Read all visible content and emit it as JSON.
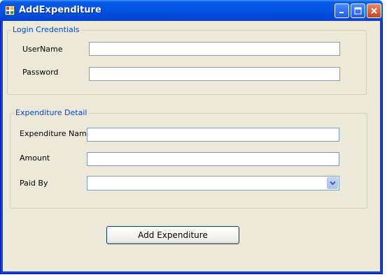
{
  "window": {
    "title": "AddExpenditure"
  },
  "login": {
    "legend": "Login Credentials",
    "username_label": "UserName",
    "username_value": "",
    "password_label": "Password",
    "password_value": ""
  },
  "detail": {
    "legend": "Expenditure Detail",
    "name_label": "Expenditure Name",
    "name_value": "",
    "amount_label": "Amount",
    "amount_value": "",
    "paidby_label": "Paid By",
    "paidby_value": ""
  },
  "actions": {
    "add_label": "Add Expenditure"
  },
  "icons": {
    "app": "app-icon",
    "minimize": "minimize-icon",
    "maximize": "maximize-icon",
    "close": "close-icon",
    "dropdown": "chevron-down-icon"
  },
  "colors": {
    "titlebar": "#0255e5",
    "client": "#ece9d8",
    "legend": "#0046d5"
  }
}
